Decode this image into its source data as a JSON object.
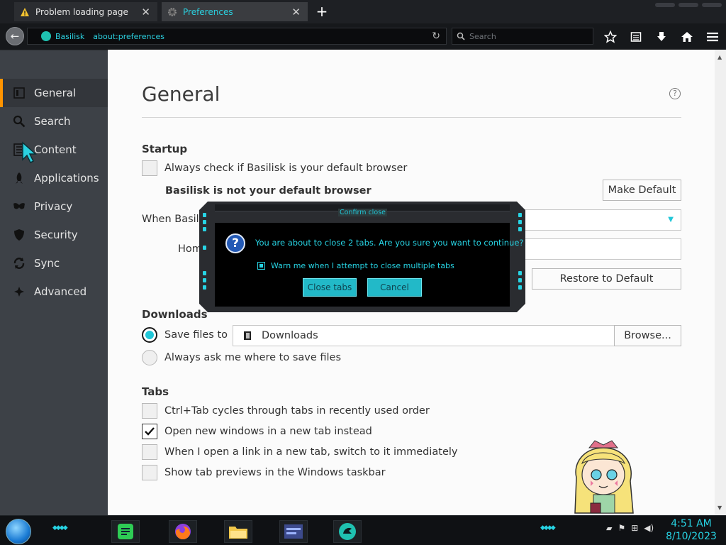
{
  "tabs": [
    {
      "label": "Problem loading page",
      "icon": "warning-icon"
    },
    {
      "label": "Preferences",
      "icon": "gear-icon"
    }
  ],
  "nav": {
    "identity": "Basilisk",
    "url": "about:preferences",
    "search_placeholder": "Search"
  },
  "sidebar": {
    "items": [
      {
        "label": "General",
        "icon": "general-icon",
        "active": true
      },
      {
        "label": "Search",
        "icon": "search-icon"
      },
      {
        "label": "Content",
        "icon": "content-icon"
      },
      {
        "label": "Applications",
        "icon": "applications-icon"
      },
      {
        "label": "Privacy",
        "icon": "privacy-icon"
      },
      {
        "label": "Security",
        "icon": "security-icon"
      },
      {
        "label": "Sync",
        "icon": "sync-icon"
      },
      {
        "label": "Advanced",
        "icon": "advanced-icon"
      }
    ]
  },
  "page": {
    "title": "General",
    "startup": {
      "heading": "Startup",
      "default_check": "Always check if Basilisk is your default browser",
      "default_status": "Basilisk is not your default browser",
      "make_default": "Make Default",
      "when_label": "When Basilisk",
      "home_label": "Hom",
      "restore_default": "Restore to Default"
    },
    "downloads": {
      "heading": "Downloads",
      "save_to": "Save files to",
      "folder": "Downloads",
      "browse": "Browse...",
      "always_ask": "Always ask me where to save files"
    },
    "tabs": {
      "heading": "Tabs",
      "opt1": "Ctrl+Tab cycles through tabs in recently used order",
      "opt2": "Open new windows in a new tab instead",
      "opt3": "When I open a link in a new tab, switch to it immediately",
      "opt4": "Show tab previews in the Windows taskbar"
    }
  },
  "dialog": {
    "title": "Confirm close",
    "message": "You are about to close 2 tabs. Are you sure you want to continue?",
    "warn": "Warn me when I attempt to close multiple tabs",
    "warn_checked": true,
    "close_btn": "Close tabs",
    "cancel_btn": "Cancel"
  },
  "clock": {
    "time": "4:51 AM",
    "date": "8/10/2023"
  },
  "colors": {
    "accent": "#27d4e4",
    "active_marker": "#ff9400",
    "sidebar": "#3d4147"
  }
}
